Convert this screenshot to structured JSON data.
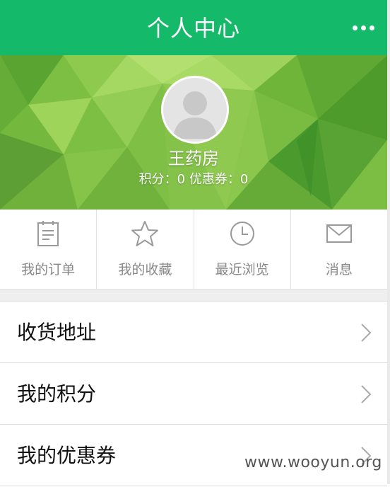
{
  "header": {
    "title": "个人中心",
    "more_icon": "more-dots-icon"
  },
  "profile": {
    "avatar_icon": "default-avatar-icon",
    "username": "王药房",
    "stats": "积分：0 优惠券：0",
    "background_colors": [
      "#4f9e2e",
      "#8fcf4b",
      "#b6e06a"
    ]
  },
  "quick_actions": [
    {
      "label": "我的订单",
      "icon": "order-list-icon"
    },
    {
      "label": "我的收藏",
      "icon": "star-icon"
    },
    {
      "label": "最近浏览",
      "icon": "clock-icon"
    },
    {
      "label": "消息",
      "icon": "envelope-icon"
    }
  ],
  "menu": [
    {
      "label": "收货地址",
      "icon": "chevron-right-icon"
    },
    {
      "label": "我的积分",
      "icon": "chevron-right-icon"
    },
    {
      "label": "我的优惠券",
      "icon": "chevron-right-icon"
    }
  ],
  "watermark": "www.wooyun.org",
  "colors": {
    "header": "#14b96a",
    "icon_gray": "#9a9a9a"
  }
}
